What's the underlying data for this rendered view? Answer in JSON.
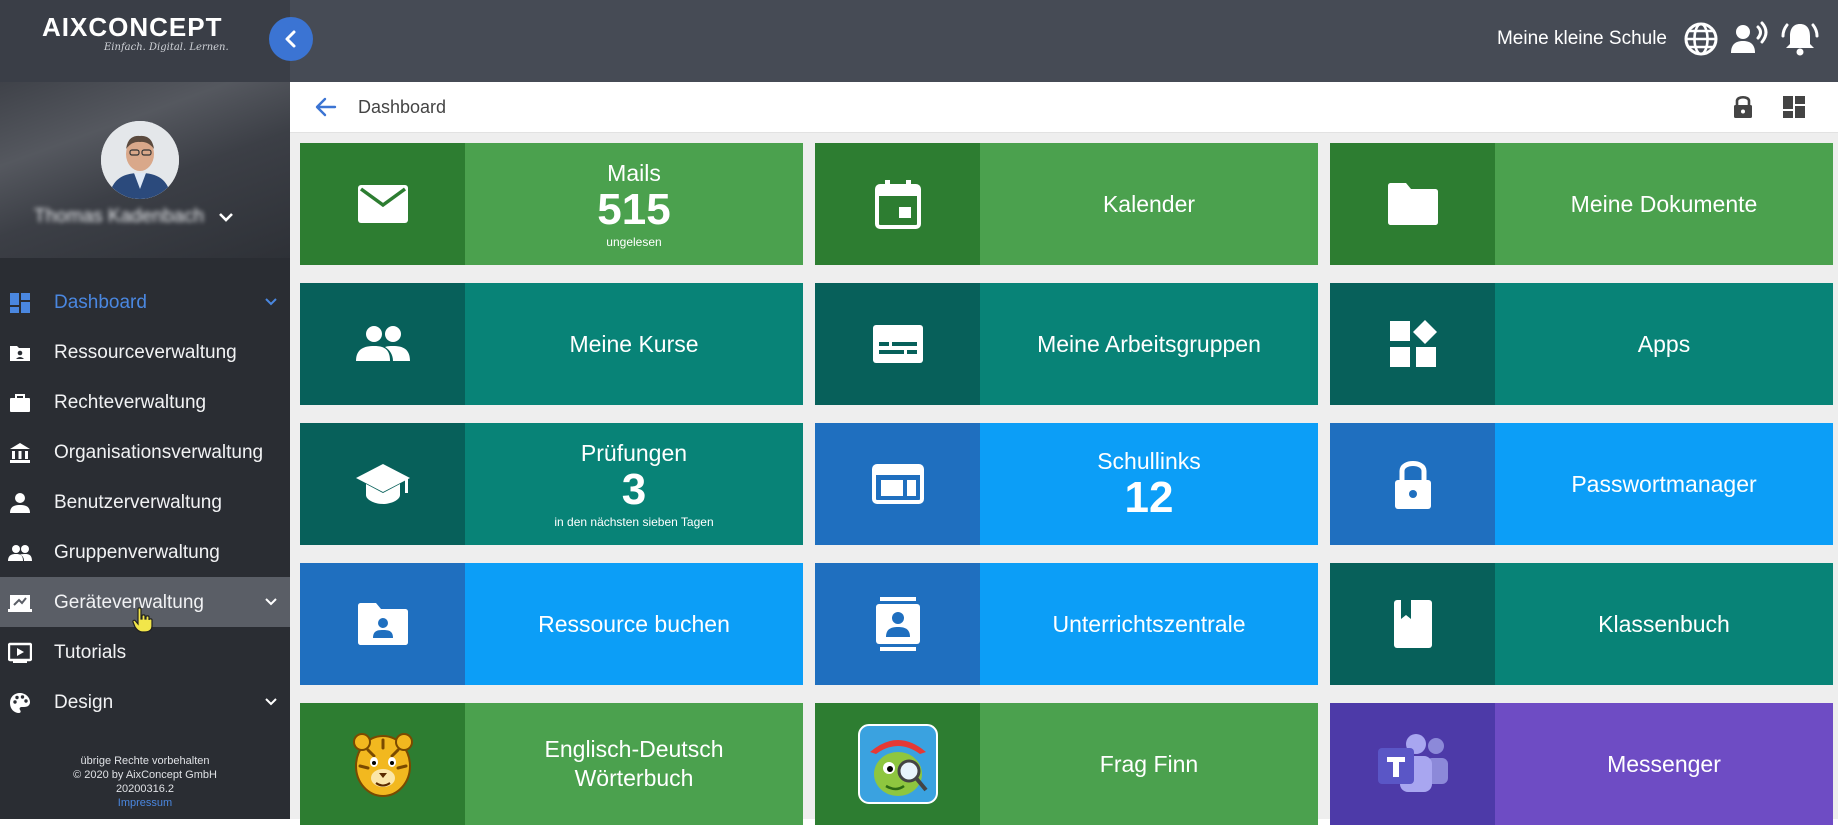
{
  "brand": {
    "name": "AIXCONCEPT",
    "tagline": "Einfach. Digital. Lernen."
  },
  "header": {
    "school": "Meine kleine Schule",
    "icons": [
      "globe-icon",
      "speaker-icon",
      "bell-icon"
    ]
  },
  "user": {
    "name": "Thomas Kadenbach"
  },
  "sidebar": {
    "items": [
      {
        "label": "Dashboard",
        "icon": "dashboard-icon"
      },
      {
        "label": "Ressourceverwaltung",
        "icon": "folder-user-icon"
      },
      {
        "label": "Rechteverwaltung",
        "icon": "briefcase-icon"
      },
      {
        "label": "Organisationsverwaltung",
        "icon": "bank-icon"
      },
      {
        "label": "Benutzerverwaltung",
        "icon": "person-icon"
      },
      {
        "label": "Gruppenverwaltung",
        "icon": "people-icon"
      },
      {
        "label": "Geräteverwaltung",
        "icon": "device-icon"
      },
      {
        "label": "Tutorials",
        "icon": "play-icon"
      },
      {
        "label": "Design",
        "icon": "palette-icon"
      }
    ],
    "footer": {
      "line1": "übrige Rechte vorbehalten",
      "line2": "© 2020 by AixConcept GmbH",
      "line3": "20200316.2",
      "link": "Impressum"
    }
  },
  "breadcrumb": {
    "title": "Dashboard"
  },
  "tiles": [
    {
      "label": "Mails",
      "count": "515",
      "sub": "ungelesen",
      "icon": "mail-icon"
    },
    {
      "label": "Kalender",
      "icon": "calendar-icon"
    },
    {
      "label": "Meine Dokumente",
      "icon": "folder-icon"
    },
    {
      "label": "Meine Kurse",
      "icon": "group-icon"
    },
    {
      "label": "Meine Arbeitsgruppen",
      "icon": "subtitles-icon"
    },
    {
      "label": "Apps",
      "icon": "apps-icon"
    },
    {
      "label": "Prüfungen",
      "count": "3",
      "sub": "in den nächsten sieben Tagen",
      "icon": "graduation-cap-icon"
    },
    {
      "label": "Schullinks",
      "count": "12",
      "icon": "web-icon"
    },
    {
      "label": "Passwortmanager",
      "icon": "lock-icon"
    },
    {
      "label": "Ressource buchen",
      "icon": "folder-shared-icon"
    },
    {
      "label": "Unterrichtszentrale",
      "icon": "contact-card-icon"
    },
    {
      "label": "Klassenbuch",
      "icon": "book-icon"
    },
    {
      "label": "Englisch-Deutsch Wörterbuch",
      "icon": "tiger-icon"
    },
    {
      "label": "Frag Finn",
      "icon": "fragfinn-logo-icon"
    },
    {
      "label": "Messenger",
      "icon": "teams-icon"
    }
  ]
}
